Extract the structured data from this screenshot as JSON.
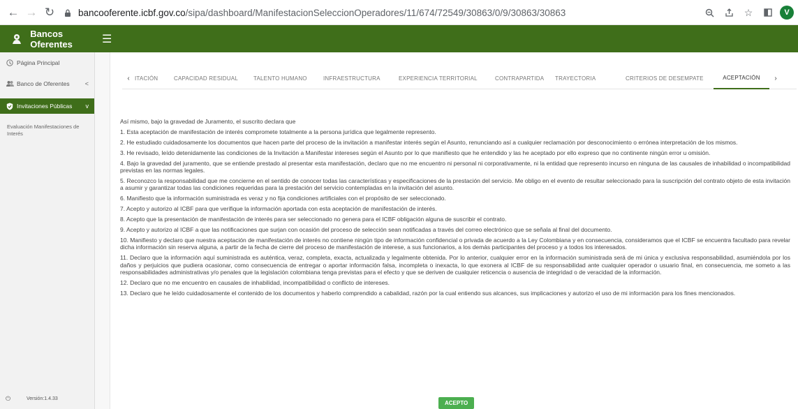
{
  "browser": {
    "url_host": "bancooferente.icbf.gov.co",
    "url_path": "/sipa/dashboard/ManifestacionSeleccionOperadores/11/674/72549/30863/0/9/30863/30863",
    "profile_initial": "V",
    "icons": [
      "back-icon",
      "forward-icon",
      "reload-icon",
      "lock-icon",
      "zoom-icon",
      "share-icon",
      "star-icon",
      "window-icon"
    ]
  },
  "header": {
    "brand": "Bancos Oferentes"
  },
  "sidebar": {
    "items": [
      {
        "label": "Página Principal",
        "icon": "home-icon"
      },
      {
        "label": "Banco de Oferentes",
        "icon": "users-icon",
        "chevron": "<"
      },
      {
        "label": "Invitaciones Públicas",
        "icon": "shield-icon",
        "chevron": "v"
      }
    ],
    "sub_item": "Evaluación Manifestaciones de Interés",
    "version": "Versión:1.4.33"
  },
  "tabs": {
    "items": [
      "ITACIÓN",
      "CAPACIDAD RESIDUAL",
      "TALENTO HUMANO",
      "INFRAESTRUCTURA",
      "EXPERIENCIA TERRITORIAL",
      "CONTRAPARTIDA",
      "TRAYECTORIA",
      "CRITERIOS DE DESEMPATE",
      "ACEPTACIÓN"
    ],
    "active": "ACEPTACIÓN"
  },
  "content": {
    "paragraphs": [
      "Así mismo, bajo la gravedad de Juramento, el suscrito declara que",
      "1. Esta aceptación de manifestación de interés compromete totalmente a la persona jurídica que legalmente represento.",
      "2. He estudiado cuidadosamente los documentos que hacen parte del proceso de la invitación a manifestar interés según el Asunto, renunciando así a cualquier reclamación por desconocimiento o errónea interpretación de los mismos.",
      "3. He revisado, leído detenidamente las condiciones de la Invitación a Manifestar intereses según el Asunto por lo que manifiesto que he entendido y las he aceptado por ello expreso que no continente ningún error u omisión.",
      "4. Bajo la gravedad del juramento, que se entiende prestado al presentar esta manifestación, declaro que no me encuentro ni personal ni corporativamente, ni la entidad que represento incurso en ninguna de las causales de inhabilidad o incompatibilidad previstas en las normas legales.",
      "5. Reconozco la responsabilidad que me concierne en el sentido de conocer todas las características y especificaciones de la prestación del servicio. Me obligo en el evento de resultar seleccionado para la suscripción del contrato objeto de esta invitación a asumir y garantizar todas las condiciones requeridas para la prestación del servicio contempladas en la invitación del asunto.",
      "6. Manifiesto que la información suministrada es veraz y no fija condiciones artificiales con el propósito de ser seleccionado.",
      "7. Acepto y autorizo al ICBF para que verifique la información aportada con esta aceptación de manifestación de interés.",
      "8. Acepto que la presentación de manifestación de interés para ser seleccionado no genera para el ICBF obligación alguna de suscribir el contrato.",
      "9. Acepto y autorizo al ICBF a que las notificaciones que surjan con ocasión del proceso de selección sean notificadas a través del correo electrónico que se señala al final del documento.",
      "10. Manifiesto y declaro que nuestra aceptación de manifestación de interés no contiene ningún tipo de información confidencial o privada de acuerdo a la Ley Colombiana y en consecuencia, consideramos que el ICBF se encuentra facultado para revelar dicha información sin reserva alguna, a partir de la fecha de cierre del proceso de manifestación de interese, a sus funcionarios, a los demás participantes del proceso y a todos los interesados.",
      "11. Declaro que la información aquí suministrada es auténtica, veraz, completa, exacta, actualizada y legalmente obtenida. Por lo anterior, cualquier error en la información suministrada será de mi única y exclusiva responsabilidad, asumiéndola por los daños y perjuicios que pudiera ocasionar, como consecuencia de entregar o aportar información falsa, incompleta o inexacta, lo que exonera al ICBF de su responsabilidad ante cualquier operador o usuario final, en consecuencia, me someto a las responsabilidades administrativas y/o penales que la legislación colombiana tenga previstas para el efecto y que se deriven de cualquier reticencia o ausencia de integridad o de veracidad de la información.",
      "12. Declaro que no me encuentro en causales de inhabilidad, incompatibilidad o conflicto de intereses.",
      "13. Declaro que he leído cuidadosamente el contenido de los documentos y haberlo comprendido a cabalidad, razón por la cual entiendo sus alcances, sus implicaciones y autorizo el uso de mi información para los fines mencionados."
    ],
    "accept_label": "ACEPTO"
  },
  "colors": {
    "header_green": "#3f6e1a",
    "accept_green": "#4caf50",
    "profile_green": "#188038"
  }
}
